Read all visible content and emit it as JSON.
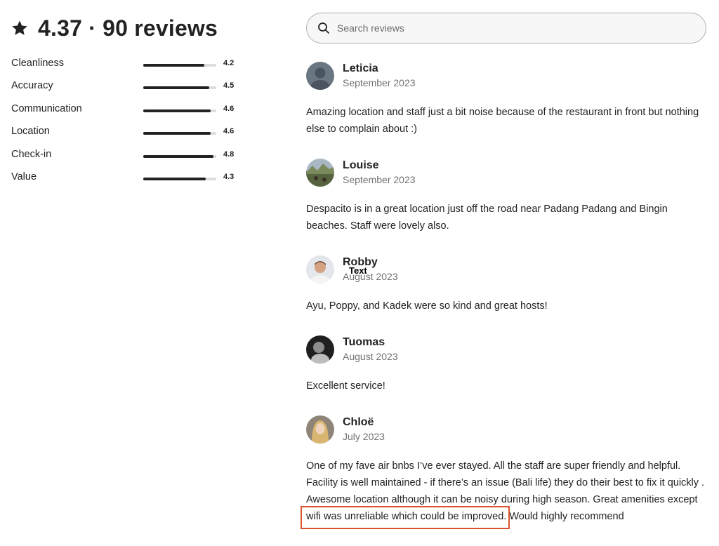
{
  "summary": {
    "icon": "star-icon",
    "text": "4.37 · 90 reviews"
  },
  "ratings": [
    {
      "label": "Cleanliness",
      "value": "4.2",
      "score": 4.2
    },
    {
      "label": "Accuracy",
      "value": "4.5",
      "score": 4.5
    },
    {
      "label": "Communication",
      "value": "4.6",
      "score": 4.6
    },
    {
      "label": "Location",
      "value": "4.6",
      "score": 4.6
    },
    {
      "label": "Check-in",
      "value": "4.8",
      "score": 4.8
    },
    {
      "label": "Value",
      "value": "4.3",
      "score": 4.3
    }
  ],
  "rating_max": 5,
  "search": {
    "icon": "search-icon",
    "placeholder": "Search reviews"
  },
  "reviews": [
    {
      "name": "Leticia",
      "date": "September 2023",
      "text": "Amazing location and staff just a bit noise because of the restaurant in front but nothing else to complain about :)"
    },
    {
      "name": "Louise",
      "date": "September 2023",
      "text": "Despacito is in a great location just off the road near Padang Padang and Bingin beaches. Staff were lovely also."
    },
    {
      "name": "Robby",
      "date": "August 2023",
      "text": "Ayu, Poppy, and Kadek were so kind and great hosts!"
    },
    {
      "name": "Tuomas",
      "date": "August 2023",
      "text": "Excellent service!"
    },
    {
      "name": "Chloë",
      "date": "July 2023",
      "text": "One of my fave air bnbs I’ve ever stayed. All the staff are super friendly and helpful. Facility is well maintained - if there’s an issue (Bali life) they do their best to fix it quickly . Awesome location although it can be noisy during high season. Great amenities except wifi was unreliable which could be improved. Would highly recommend"
    }
  ],
  "overlay_label": "Text",
  "colors": {
    "text": "#222222",
    "muted": "#717171",
    "track": "#dddddd",
    "highlight": "#d9542f"
  }
}
